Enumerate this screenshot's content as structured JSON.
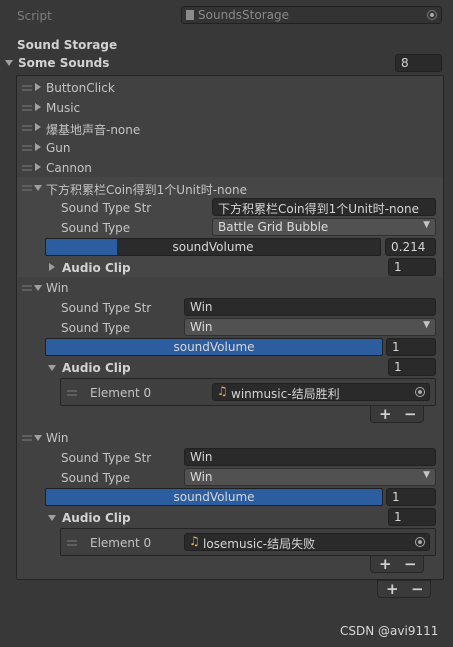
{
  "script": {
    "label": "Script",
    "value": "SoundsStorage",
    "icon": "script-file-icon"
  },
  "component": {
    "header": "Sound Storage"
  },
  "list": {
    "label": "Some Sounds",
    "size": "8",
    "collapsed_items": [
      "ButtonClick",
      "Music",
      "爆基地声音-none",
      "Gun",
      "Cannon"
    ],
    "item6": {
      "title": "下方积累栏Coin得到1个Unit时-none",
      "sound_type_str_label": "Sound Type Str",
      "sound_type_str_value": "下方积累栏Coin得到1个Unit时-none",
      "sound_type_label": "Sound Type",
      "sound_type_value": "Battle Grid Bubble",
      "volume_label": "soundVolume",
      "volume_value": "0.214",
      "volume_fraction": 0.214,
      "audio_clip_label": "Audio Clip",
      "audio_clip_size": "1"
    },
    "item7": {
      "title": "Win",
      "sound_type_str_label": "Sound Type Str",
      "sound_type_str_value": "Win",
      "sound_type_label": "Sound Type",
      "sound_type_value": "Win",
      "volume_label": "soundVolume",
      "volume_value": "1",
      "volume_fraction": 1,
      "audio_clip_label": "Audio Clip",
      "audio_clip_size": "1",
      "element_label": "Element 0",
      "element_value": "winmusic-结局胜利"
    },
    "item8": {
      "title": "Win",
      "sound_type_str_label": "Sound Type Str",
      "sound_type_str_value": "Win",
      "sound_type_label": "Sound Type",
      "sound_type_value": "Win",
      "volume_label": "soundVolume",
      "volume_value": "1",
      "volume_fraction": 1,
      "audio_clip_label": "Audio Clip",
      "audio_clip_size": "1",
      "element_label": "Element 0",
      "element_value": "losemusic-结局失败"
    }
  },
  "buttons": {
    "plus": "+",
    "minus": "−"
  },
  "watermark": "CSDN @avi9111",
  "colors": {
    "accent": "#2c5d9e",
    "background": "#383838",
    "field": "#2a2a2a"
  }
}
